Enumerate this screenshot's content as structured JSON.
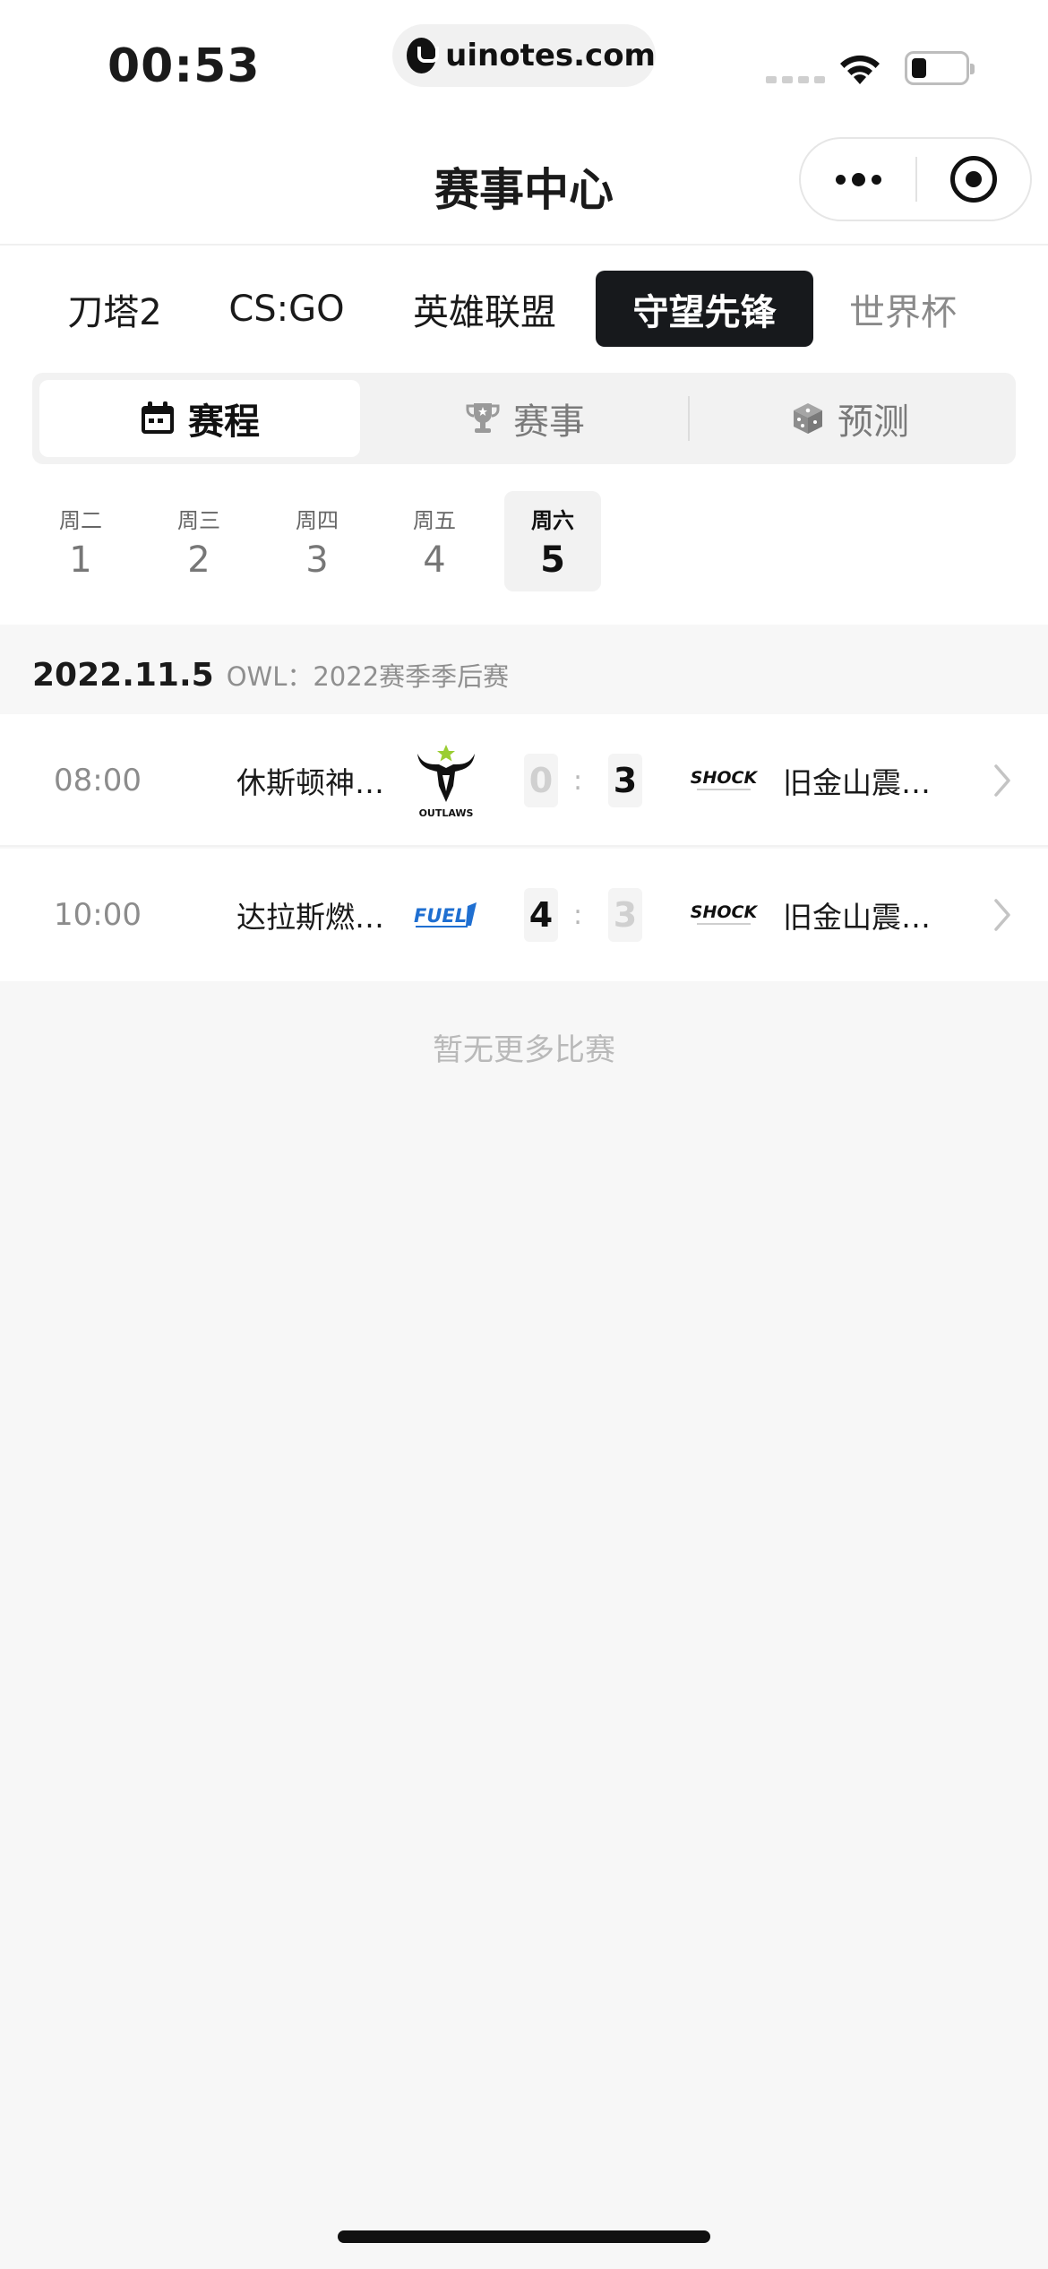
{
  "status": {
    "time": "00:53",
    "url": "uinotes.com"
  },
  "header": {
    "title": "赛事中心"
  },
  "game_tabs": [
    {
      "label": "刀塔2"
    },
    {
      "label": "CS:GO"
    },
    {
      "label": "英雄联盟"
    },
    {
      "label": "守望先锋"
    },
    {
      "label": "世界杯"
    }
  ],
  "segments": [
    {
      "label": "赛程",
      "icon": "calendar-icon"
    },
    {
      "label": "赛事",
      "icon": "trophy-icon"
    },
    {
      "label": "预测",
      "icon": "dice-icon"
    }
  ],
  "days": [
    {
      "week": "周二",
      "num": "1"
    },
    {
      "week": "周三",
      "num": "2"
    },
    {
      "week": "周四",
      "num": "3"
    },
    {
      "week": "周五",
      "num": "4"
    },
    {
      "week": "周六",
      "num": "5"
    }
  ],
  "section": {
    "date": "2022.11.5",
    "name": "OWL：2022赛季季后赛"
  },
  "matches": [
    {
      "time": "08:00",
      "team1": "休斯顿神…",
      "team1_logo": "OUTLAWS",
      "score1": "0",
      "score2": "3",
      "team2_logo": "SHOCK",
      "team2": "旧金山震…"
    },
    {
      "time": "10:00",
      "team1": "达拉斯燃…",
      "team1_logo": "FUEL",
      "score1": "4",
      "score2": "3",
      "team2_logo": "SHOCK",
      "team2": "旧金山震…"
    }
  ],
  "footer": {
    "no_more": "暂无更多比赛"
  },
  "colors": {
    "active_tab_bg": "#17191c",
    "fuel_blue": "#1f6fd1",
    "outlaws_green": "#9acd32"
  }
}
